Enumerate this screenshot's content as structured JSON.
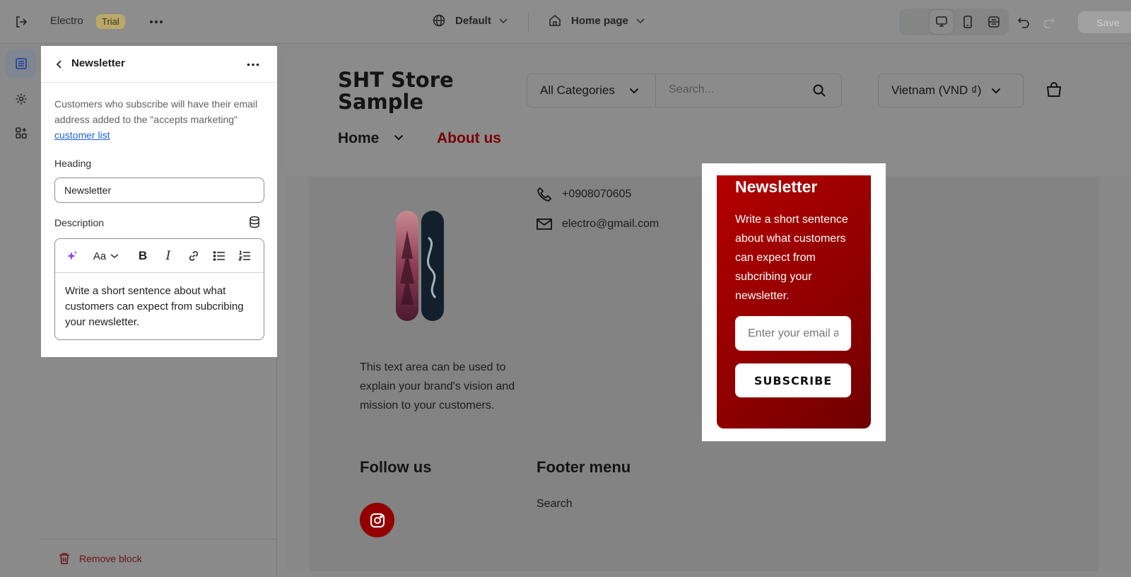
{
  "topbar": {
    "exit_icon": "exit-icon",
    "store_name": "Electro",
    "trial_badge": "Trial",
    "more_icon": "more-horizontal-icon",
    "theme_dropdown": "Default",
    "page_dropdown": "Home page",
    "save_label": "Save"
  },
  "rail": {
    "items": [
      "sections-icon",
      "settings-icon",
      "apps-icon"
    ]
  },
  "panel": {
    "title": "Newsletter",
    "info_text": "Customers who subscribe will have their email address added to the \"accepts marketing\" ",
    "info_link": "customer list",
    "heading_label": "Heading",
    "heading_value": "Newsletter",
    "description_label": "Description",
    "description_value": "Write a short sentence about what customers can expect from subcribing your newsletter.",
    "remove_label": "Remove block"
  },
  "store": {
    "logo_line1": "SHT Store",
    "logo_line2": "Sample",
    "category_select": "All Categories",
    "search_placeholder": "Search...",
    "country_select": "Vietnam (VND ₫)",
    "nav": [
      "Home",
      "About us"
    ],
    "about_text": "This text area can be used to explain your brand's vision and mission to your customers.",
    "phone": "+0908070605",
    "email": "electro@gmail.com",
    "follow_heading": "Follow us",
    "footer_menu_heading": "Footer menu",
    "footer_menu_items": [
      "Search"
    ]
  },
  "newsletter": {
    "title": "Newsletter",
    "description": "Write a short sentence about what customers can expect from subcribing your newsletter.",
    "email_placeholder": "Enter your email address",
    "button_label": "SUBSCRIBE"
  },
  "colors": {
    "accent_red": "#930000",
    "link_blue": "#1d63d5"
  }
}
